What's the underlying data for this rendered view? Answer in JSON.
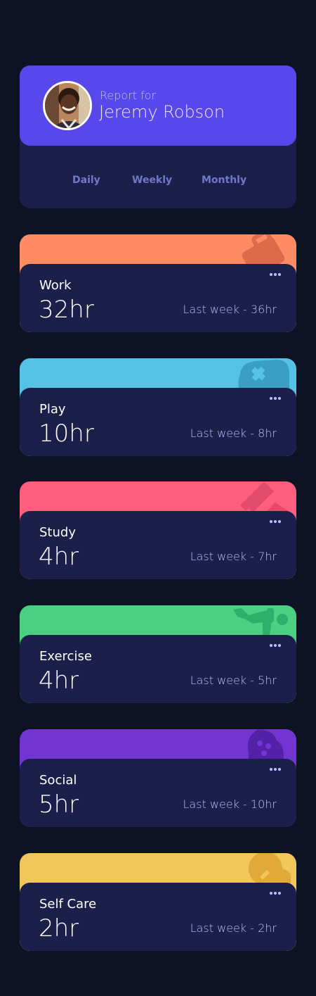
{
  "profile": {
    "report_label": "Report for",
    "name": "Jeremy Robson",
    "timeframes": [
      "Daily",
      "Weekly",
      "Monthly"
    ]
  },
  "activities": [
    {
      "title": "Work",
      "current": "32hr",
      "previous": "Last week - 36hr",
      "color": "#ff8b64",
      "icon": "briefcase-icon"
    },
    {
      "title": "Play",
      "current": "10hr",
      "previous": "Last week - 8hr",
      "color": "#55c2e6",
      "icon": "gamepad-icon"
    },
    {
      "title": "Study",
      "current": "4hr",
      "previous": "Last week - 7hr",
      "color": "#ff5e7d",
      "icon": "book-icon"
    },
    {
      "title": "Exercise",
      "current": "4hr",
      "previous": "Last week - 5hr",
      "color": "#4bcf82",
      "icon": "running-icon"
    },
    {
      "title": "Social",
      "current": "5hr",
      "previous": "Last week - 10hr",
      "color": "#7335d2",
      "icon": "chat-icon"
    },
    {
      "title": "Self Care",
      "current": "2hr",
      "previous": "Last week - 2hr",
      "color": "#f1c75b",
      "icon": "heart-icon"
    }
  ],
  "colors": {
    "background": "#0e1323",
    "card": "#1c1f4a",
    "accent": "#5847eb",
    "muted_text": "#bbc0ff",
    "timeframe_text": "#7078c9"
  }
}
